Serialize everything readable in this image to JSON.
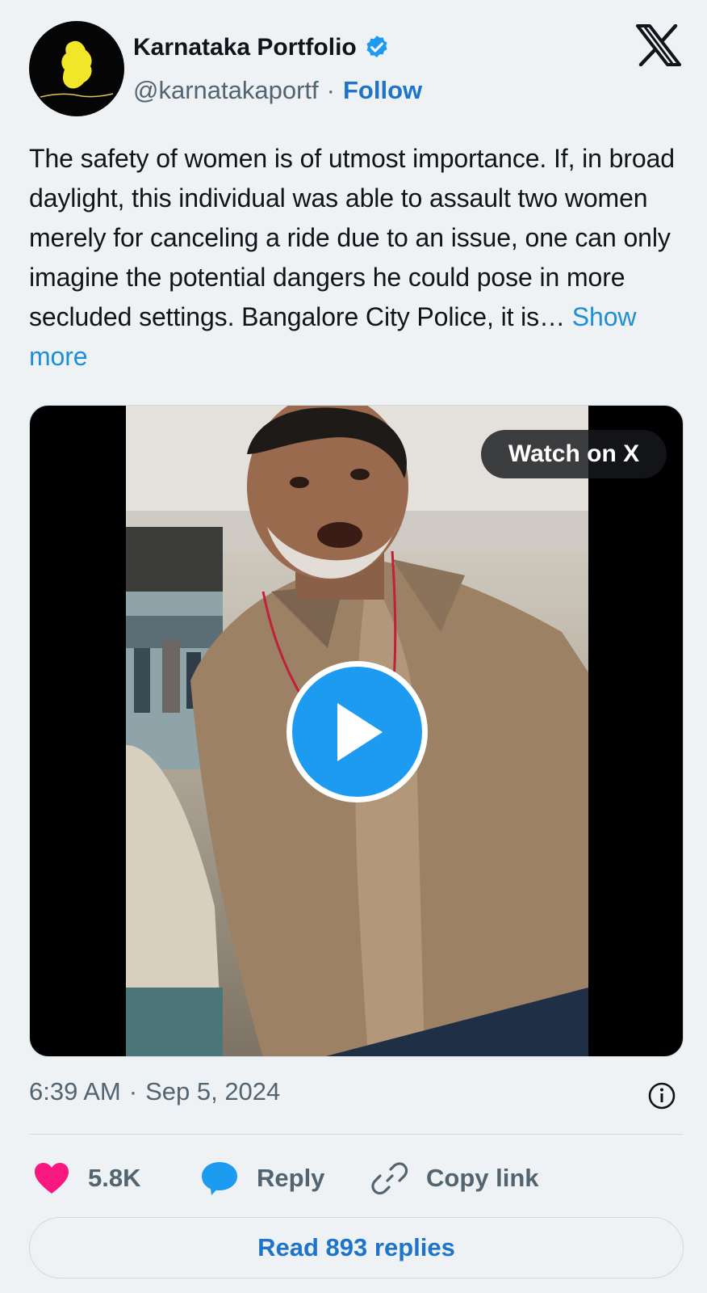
{
  "author": {
    "name": "Karnataka Portfolio",
    "handle": "@karnatakaportf",
    "separator": "·",
    "follow_label": "Follow",
    "avatar_text": "Karnataka Portfolio",
    "verified": true
  },
  "post": {
    "text": "The safety of women is of utmost importance. If, in broad daylight, this individual was able to assault two women merely for canceling a ride due to an issue, one can only imagine the potential dangers he could pose in more secluded settings. Bangalore City Police, it is…",
    "show_more_label": "Show more"
  },
  "media": {
    "watch_label": "Watch on X",
    "play_icon": "play-icon"
  },
  "meta": {
    "time": "6:39 AM",
    "separator": "·",
    "date": "Sep 5, 2024"
  },
  "actions": {
    "likes": "5.8K",
    "reply_label": "Reply",
    "copy_label": "Copy link"
  },
  "read_replies_label": "Read 893 replies",
  "colors": {
    "background": "#eef2f5",
    "link": "#1d74c9",
    "verified": "#1d9bf0",
    "like": "#f91880",
    "reply_icon": "#1d9bf0"
  }
}
